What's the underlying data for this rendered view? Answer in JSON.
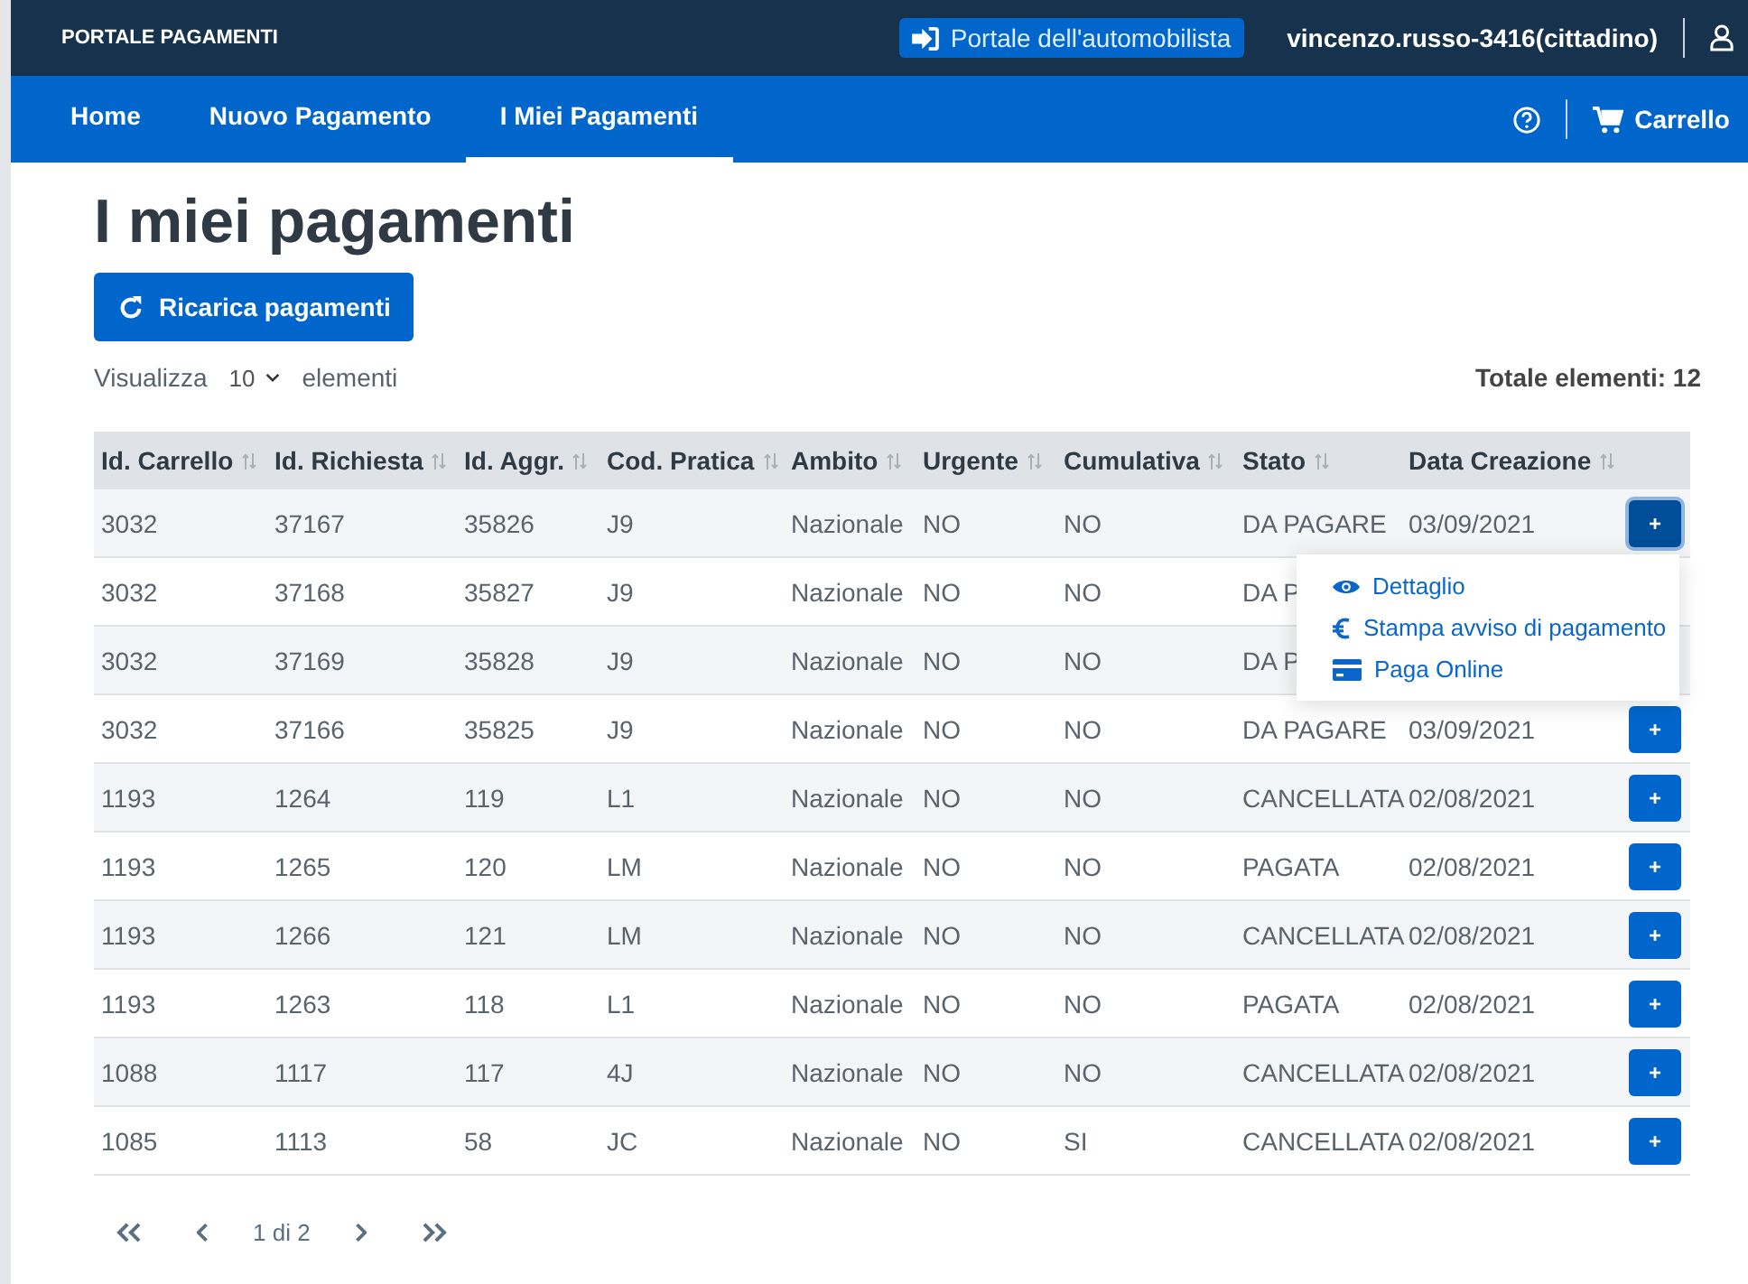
{
  "top_bar": {
    "brand": "PORTALE PAGAMENTI",
    "portal_link": "Portale dell'automobilista",
    "user": "vincenzo.russo-3416(cittadino)"
  },
  "nav": {
    "items": [
      {
        "label": "Home",
        "selected": false
      },
      {
        "label": "Nuovo Pagamento",
        "selected": false
      },
      {
        "label": "I Miei Pagamenti",
        "selected": true
      }
    ],
    "cart": "Carrello"
  },
  "page": {
    "title": "I miei pagamenti",
    "reload_button": "Ricarica pagamenti",
    "show_label": "Visualizza",
    "page_size": "10",
    "show_suffix": "elementi",
    "total": "Totale elementi: 12"
  },
  "table": {
    "columns": [
      "Id. Carrello",
      "Id. Richiesta",
      "Id. Aggr.",
      "Cod. Pratica",
      "Ambito",
      "Urgente",
      "Cumulativa",
      "Stato",
      "Data Creazione"
    ],
    "rows": [
      {
        "cells": [
          "3032",
          "37167",
          "35826",
          "J9",
          "Nazionale",
          "NO",
          "NO",
          "DA PAGARE",
          "03/09/2021"
        ],
        "action": "+",
        "menu_open": true
      },
      {
        "cells": [
          "3032",
          "37168",
          "35827",
          "J9",
          "Nazionale",
          "NO",
          "NO",
          "DA P"
        ]
      },
      {
        "cells": [
          "3032",
          "37169",
          "35828",
          "J9",
          "Nazionale",
          "NO",
          "NO",
          "DA P"
        ]
      },
      {
        "cells": [
          "3032",
          "37166",
          "35825",
          "J9",
          "Nazionale",
          "NO",
          "NO",
          "DA PAGARE",
          "03/09/2021"
        ],
        "action": "+",
        "menu_open": false
      },
      {
        "cells": [
          "1193",
          "1264",
          "119",
          "L1",
          "Nazionale",
          "NO",
          "NO",
          "CANCELLATA",
          "02/08/2021"
        ],
        "action": "+",
        "menu_open": false
      },
      {
        "cells": [
          "1193",
          "1265",
          "120",
          "LM",
          "Nazionale",
          "NO",
          "NO",
          "PAGATA",
          "02/08/2021"
        ],
        "action": "+",
        "menu_open": false
      },
      {
        "cells": [
          "1193",
          "1266",
          "121",
          "LM",
          "Nazionale",
          "NO",
          "NO",
          "CANCELLATA",
          "02/08/2021"
        ],
        "action": "+",
        "menu_open": false
      },
      {
        "cells": [
          "1193",
          "1263",
          "118",
          "L1",
          "Nazionale",
          "NO",
          "NO",
          "PAGATA",
          "02/08/2021"
        ],
        "action": "+",
        "menu_open": false
      },
      {
        "cells": [
          "1088",
          "1117",
          "117",
          "4J",
          "Nazionale",
          "NO",
          "NO",
          "CANCELLATA",
          "02/08/2021"
        ],
        "action": "+",
        "menu_open": false
      },
      {
        "cells": [
          "1085",
          "1113",
          "58",
          "JC",
          "Nazionale",
          "NO",
          "SI",
          "CANCELLATA",
          "02/08/2021"
        ],
        "action": "+",
        "menu_open": false
      }
    ]
  },
  "row_menu": {
    "items": [
      {
        "kind": "view",
        "label": "Dettaglio"
      },
      {
        "kind": "euro",
        "label": "Stampa avviso di pagamento"
      },
      {
        "kind": "card",
        "label": "Paga Online"
      }
    ]
  },
  "pagination": {
    "page_text": "1 di 2"
  }
}
